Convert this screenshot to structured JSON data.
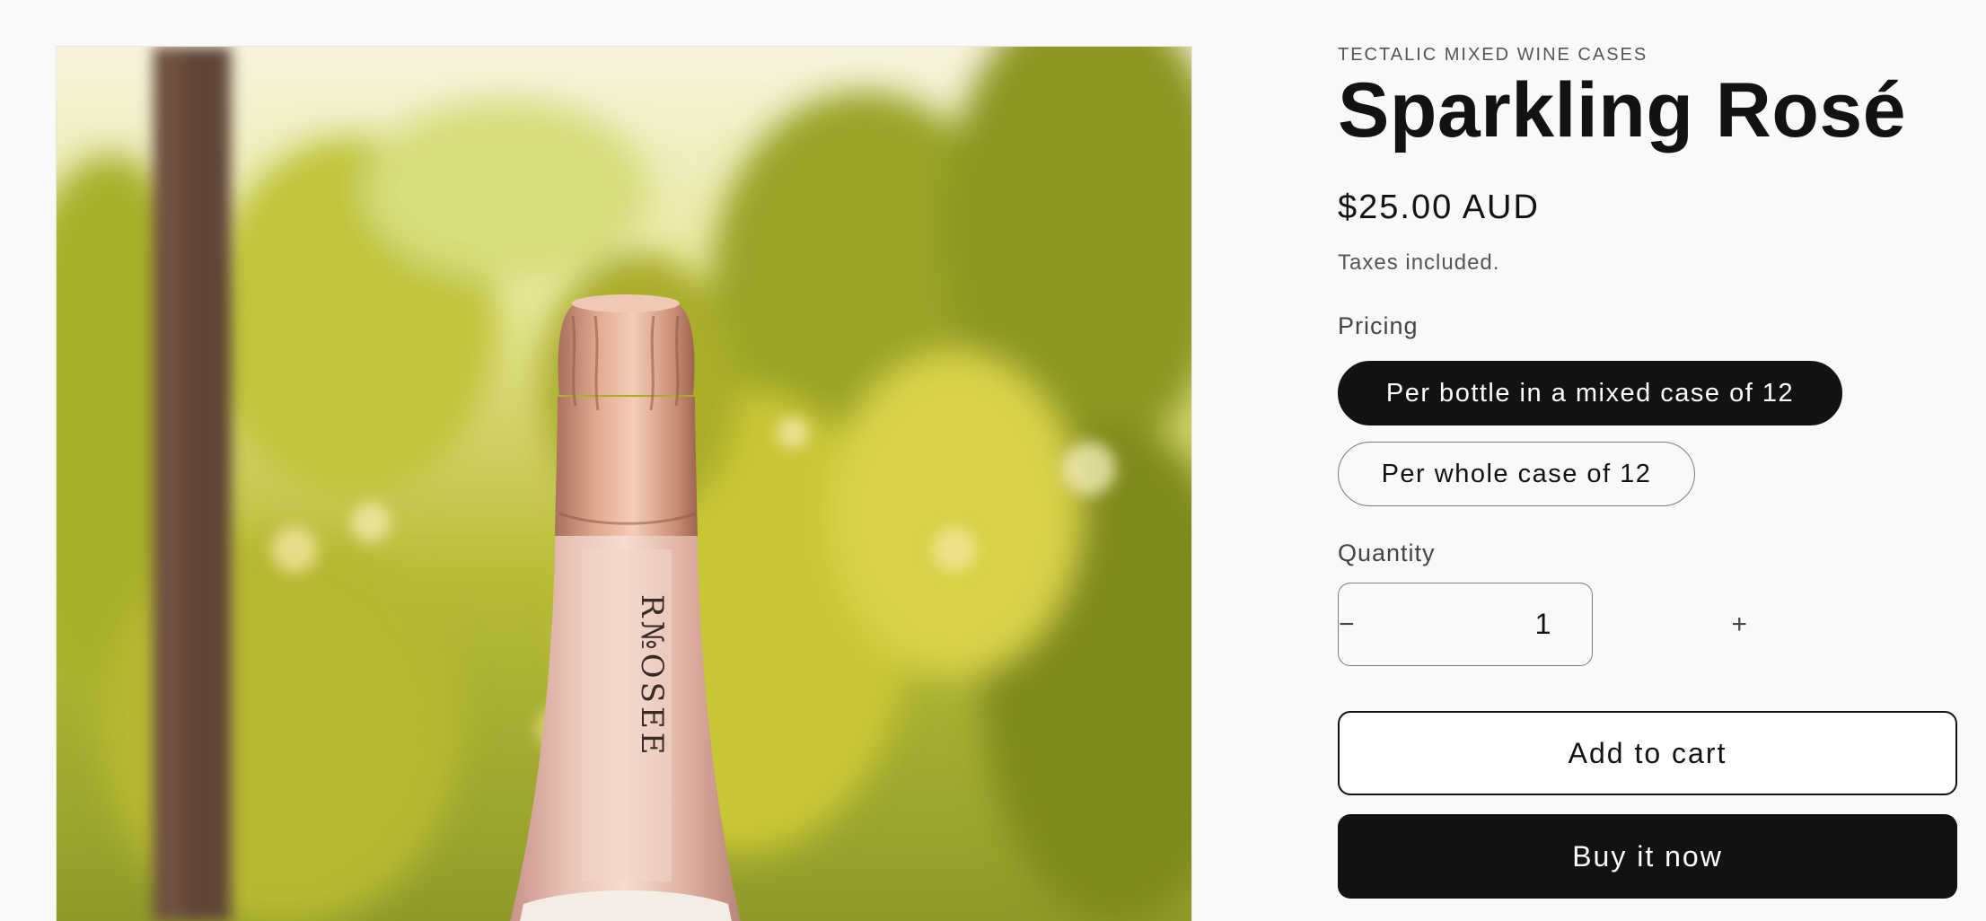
{
  "product": {
    "vendor": "TECTALIC MIXED WINE CASES",
    "title": "Sparkling Rosé",
    "price": "$25.00 AUD",
    "tax_note": "Taxes included.",
    "bottle_label_text": "R№OSEE"
  },
  "pricing": {
    "label": "Pricing",
    "options": [
      {
        "label": "Per bottle in a mixed case of 12",
        "selected": true
      },
      {
        "label": "Per whole case of 12",
        "selected": false
      }
    ]
  },
  "quantity": {
    "label": "Quantity",
    "value": "1",
    "decrement_symbol": "−",
    "increment_symbol": "+"
  },
  "actions": {
    "add_to_cart": "Add to cart",
    "buy_now": "Buy it now"
  },
  "colors": {
    "accent": "#121212",
    "background": "#faf9f9",
    "muted_text": "#555555"
  },
  "icons": {
    "decrement": "minus-icon",
    "increment": "plus-icon"
  }
}
